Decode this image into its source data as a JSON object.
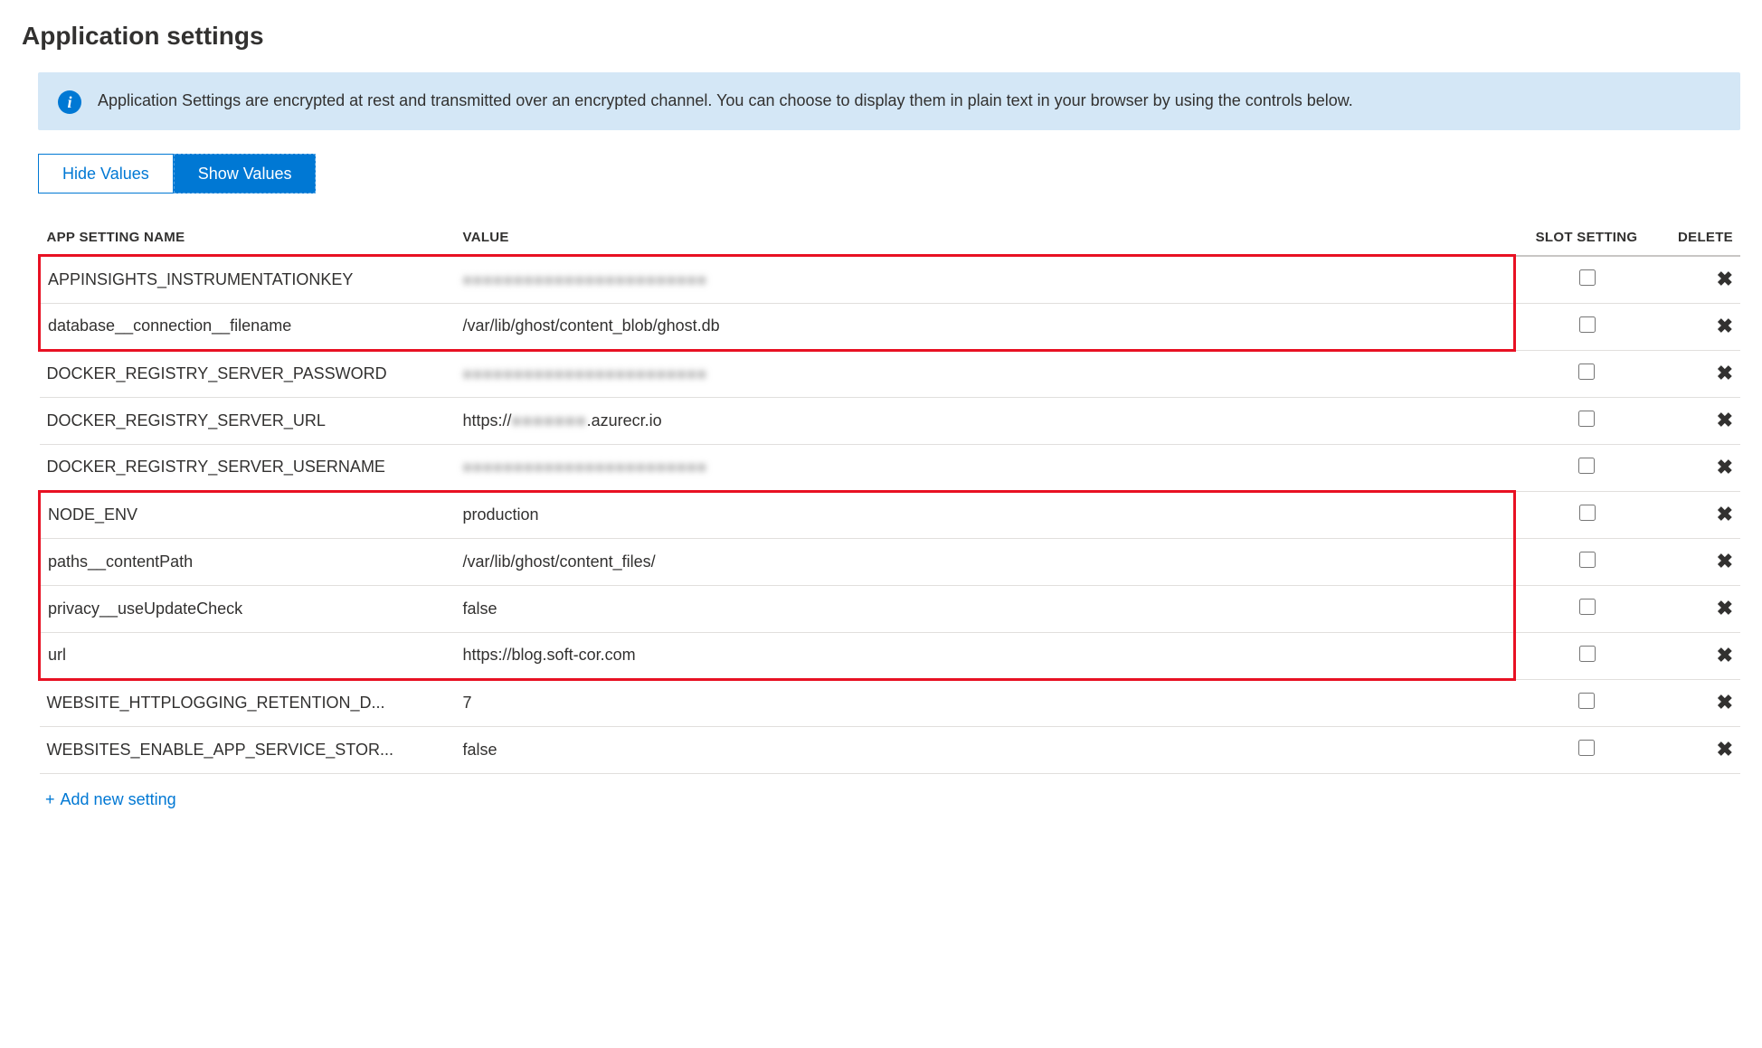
{
  "title": "Application settings",
  "info_message": "Application Settings are encrypted at rest and transmitted over an encrypted channel. You can choose to display them in plain text in your browser by using the controls below.",
  "toggle": {
    "hide_label": "Hide Values",
    "show_label": "Show Values",
    "active": "show"
  },
  "columns": {
    "name": "APP SETTING NAME",
    "value": "VALUE",
    "slot": "SLOT SETTING",
    "delete": "DELETE"
  },
  "add_new_label": "Add new setting",
  "rows": [
    {
      "name": "APPINSIGHTS_INSTRUMENTATIONKEY",
      "value": "",
      "redacted": true,
      "slot": false,
      "hl_group": 1
    },
    {
      "name": "database__connection__filename",
      "value": "/var/lib/ghost/content_blob/ghost.db",
      "redacted": false,
      "slot": false,
      "hl_group": 1
    },
    {
      "name": "DOCKER_REGISTRY_SERVER_PASSWORD",
      "value": "",
      "redacted": true,
      "slot": false,
      "hl_group": 0
    },
    {
      "name": "DOCKER_REGISTRY_SERVER_URL",
      "value_prefix": "https://",
      "value_redacted_mid": true,
      "value_suffix": ".azurecr.io",
      "redacted": false,
      "slot": false,
      "hl_group": 0
    },
    {
      "name": "DOCKER_REGISTRY_SERVER_USERNAME",
      "value": "",
      "redacted": true,
      "slot": false,
      "hl_group": 0
    },
    {
      "name": "NODE_ENV",
      "value": "production",
      "redacted": false,
      "slot": false,
      "hl_group": 2
    },
    {
      "name": "paths__contentPath",
      "value": "/var/lib/ghost/content_files/",
      "redacted": false,
      "slot": false,
      "hl_group": 2
    },
    {
      "name": "privacy__useUpdateCheck",
      "value": "false",
      "redacted": false,
      "slot": false,
      "hl_group": 2
    },
    {
      "name": "url",
      "value": "https://blog.soft-cor.com",
      "redacted": false,
      "slot": false,
      "hl_group": 2
    },
    {
      "name": "WEBSITE_HTTPLOGGING_RETENTION_D...",
      "value": "7",
      "redacted": false,
      "slot": false,
      "hl_group": 0
    },
    {
      "name": "WEBSITES_ENABLE_APP_SERVICE_STOR...",
      "value": "false",
      "redacted": false,
      "slot": false,
      "hl_group": 0
    }
  ]
}
